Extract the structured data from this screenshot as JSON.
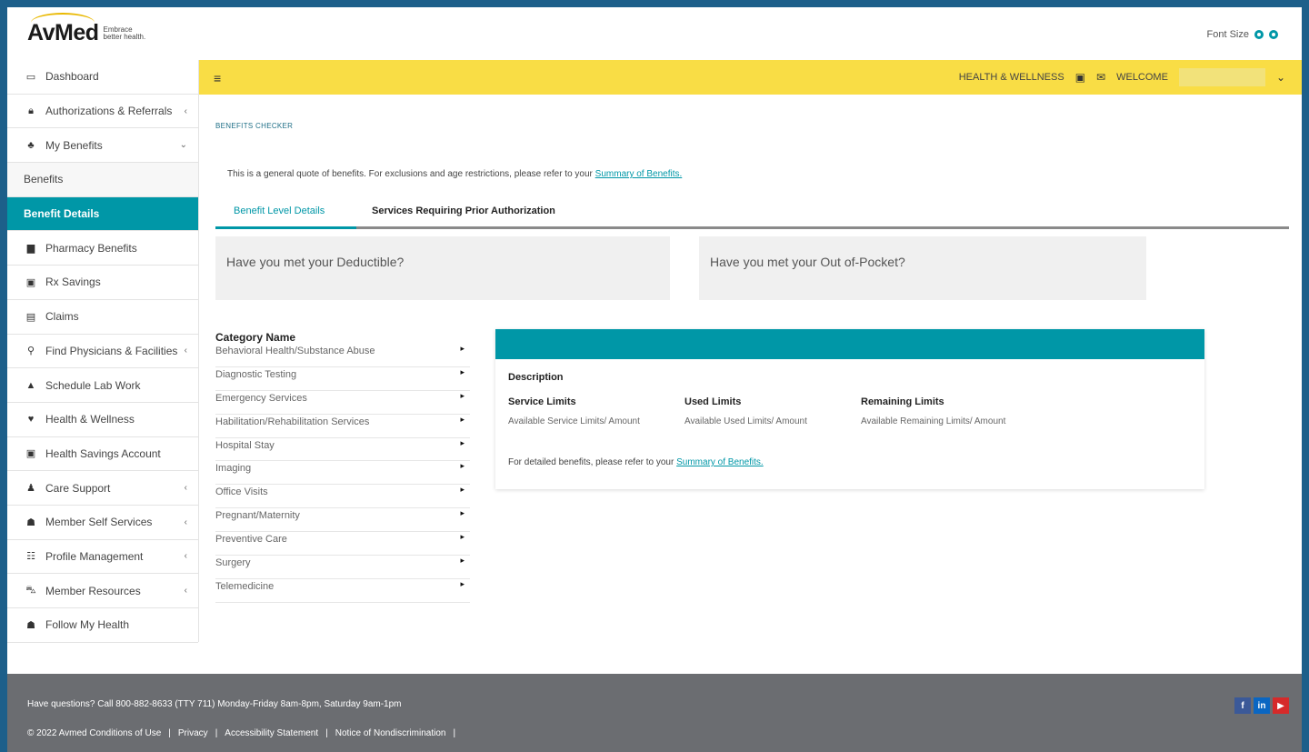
{
  "header": {
    "logo_word": "AvMed",
    "logo_tagline": "Embrace better health.",
    "font_size_label": "Font Size"
  },
  "sidebar": {
    "items": [
      {
        "label": "Dashboard",
        "icon": "monitor-icon"
      },
      {
        "label": "Authorizations & Referrals",
        "icon": "lock-icon"
      },
      {
        "label": "My Benefits",
        "icon": "handshake-icon"
      },
      {
        "label": "Benefits"
      },
      {
        "label": "Benefit Details"
      },
      {
        "label": "Pharmacy Benefits",
        "icon": "document-icon"
      },
      {
        "label": "Rx Savings",
        "icon": "card-icon"
      },
      {
        "label": "Claims",
        "icon": "file-icon"
      },
      {
        "label": "Find Physicians & Facilities",
        "icon": "search-icon"
      },
      {
        "label": "Schedule Lab Work",
        "icon": "flask-icon"
      },
      {
        "label": "Health & Wellness",
        "icon": "heart-icon"
      },
      {
        "label": "Health Savings Account",
        "icon": "card-icon"
      },
      {
        "label": "Care Support",
        "icon": "person-icon"
      },
      {
        "label": "Member Self Services",
        "icon": "group-icon"
      },
      {
        "label": "Profile Management",
        "icon": "list-icon"
      },
      {
        "label": "Member Resources",
        "icon": "car-icon"
      },
      {
        "label": "Follow My Health",
        "icon": "group-icon"
      }
    ]
  },
  "topbar": {
    "health_wellness": "HEALTH & WELLNESS",
    "welcome": "WELCOME"
  },
  "main": {
    "breadcrumb": "BENEFITS CHECKER",
    "intro_text": "This is a general quote of benefits. For exclusions and age restrictions, please refer to your",
    "intro_link": "Summary of Benefits.",
    "tabs": [
      {
        "label": "Benefit Level Details"
      },
      {
        "label": "Services Requiring Prior Authorization"
      }
    ],
    "deductible_title": "Have you met your Deductible?",
    "oop_title": "Have you met your Out of-Pocket?",
    "category_header": "Category Name",
    "categories": [
      "Behavioral Health/Substance Abuse",
      "Diagnostic Testing",
      "Emergency Services",
      "Habilitation/Rehabilitation Services",
      "Hospital Stay",
      "Imaging",
      "Office Visits",
      "Pregnant/Maternity",
      "Preventive Care",
      "Surgery",
      "Telemedicine"
    ],
    "detail": {
      "description": "Description",
      "service_limits": "Service Limits",
      "service_value": "Available Service Limits/ Amount",
      "used_limits": "Used Limits",
      "used_value": "Available Used Limits/ Amount",
      "remaining_limits": "Remaining Limits",
      "remaining_value": "Available Remaining Limits/ Amount",
      "note_text": "For detailed benefits, please refer to your",
      "note_link": "Summary of Benefits."
    }
  },
  "footer": {
    "questions": "Have questions? Call 800-882-8633 (TTY 711) Monday-Friday 8am-8pm, Saturday 9am-1pm",
    "links": [
      "© 2022 Avmed Conditions of Use",
      "|",
      "Privacy",
      "|",
      "Accessibility Statement",
      "|",
      "Notice of Nondiscrimination",
      "|"
    ],
    "social": [
      "f",
      "in",
      "▶"
    ]
  },
  "colors": {
    "accent": "#0097a7",
    "yellow": "#f9dd45",
    "footer": "#6b6d71",
    "frame": "#1d5f8a"
  }
}
